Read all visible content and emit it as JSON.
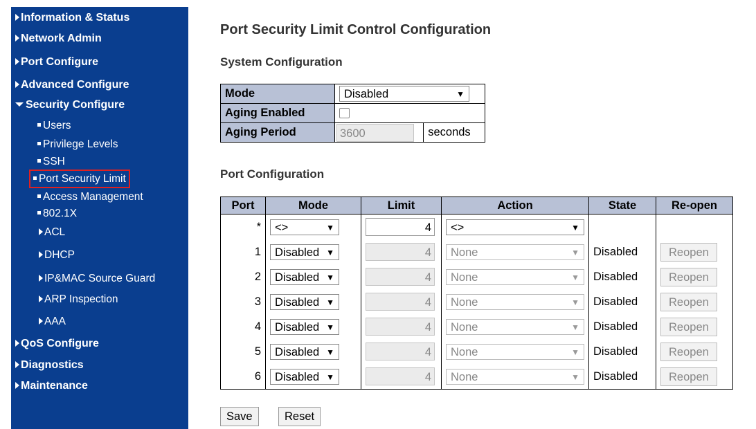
{
  "sidebar": {
    "items": [
      {
        "label": "Information & Status"
      },
      {
        "label": "Network Admin"
      },
      {
        "label": "Port Configure"
      },
      {
        "label": "Advanced Configure"
      },
      {
        "label": "Security Configure"
      },
      {
        "label": "Users"
      },
      {
        "label": "Privilege Levels"
      },
      {
        "label": "SSH"
      },
      {
        "label": "Port Security Limit"
      },
      {
        "label": "Access Management"
      },
      {
        "label": "802.1X"
      },
      {
        "label": "ACL"
      },
      {
        "label": "DHCP"
      },
      {
        "label": "IP&MAC Source Guard"
      },
      {
        "label": "ARP Inspection"
      },
      {
        "label": "AAA"
      },
      {
        "label": "QoS Configure"
      },
      {
        "label": "Diagnostics"
      },
      {
        "label": "Maintenance"
      }
    ]
  },
  "page": {
    "title": "Port Security Limit Control Configuration",
    "system_heading": "System Configuration",
    "port_heading": "Port Configuration"
  },
  "system": {
    "mode_label": "Mode",
    "mode_value": "Disabled",
    "aging_enabled_label": "Aging Enabled",
    "aging_period_label": "Aging Period",
    "aging_period_value": "3600",
    "aging_period_unit": "seconds"
  },
  "ports": {
    "headers": [
      "Port",
      "Mode",
      "Limit",
      "Action",
      "State",
      "Re-open"
    ],
    "wildcard": {
      "port": "*",
      "mode": "<>",
      "limit": "4",
      "action": "<>"
    },
    "rows": [
      {
        "port": "1",
        "mode": "Disabled",
        "limit": "4",
        "action": "None",
        "state": "Disabled",
        "reopen": "Reopen"
      },
      {
        "port": "2",
        "mode": "Disabled",
        "limit": "4",
        "action": "None",
        "state": "Disabled",
        "reopen": "Reopen"
      },
      {
        "port": "3",
        "mode": "Disabled",
        "limit": "4",
        "action": "None",
        "state": "Disabled",
        "reopen": "Reopen"
      },
      {
        "port": "4",
        "mode": "Disabled",
        "limit": "4",
        "action": "None",
        "state": "Disabled",
        "reopen": "Reopen"
      },
      {
        "port": "5",
        "mode": "Disabled",
        "limit": "4",
        "action": "None",
        "state": "Disabled",
        "reopen": "Reopen"
      },
      {
        "port": "6",
        "mode": "Disabled",
        "limit": "4",
        "action": "None",
        "state": "Disabled",
        "reopen": "Reopen"
      }
    ]
  },
  "buttons": {
    "save": "Save",
    "reset": "Reset"
  },
  "colors": {
    "sidebar_bg": "#0a3e8f",
    "header_bg": "#b8c1d6",
    "highlight": "#e02020"
  }
}
